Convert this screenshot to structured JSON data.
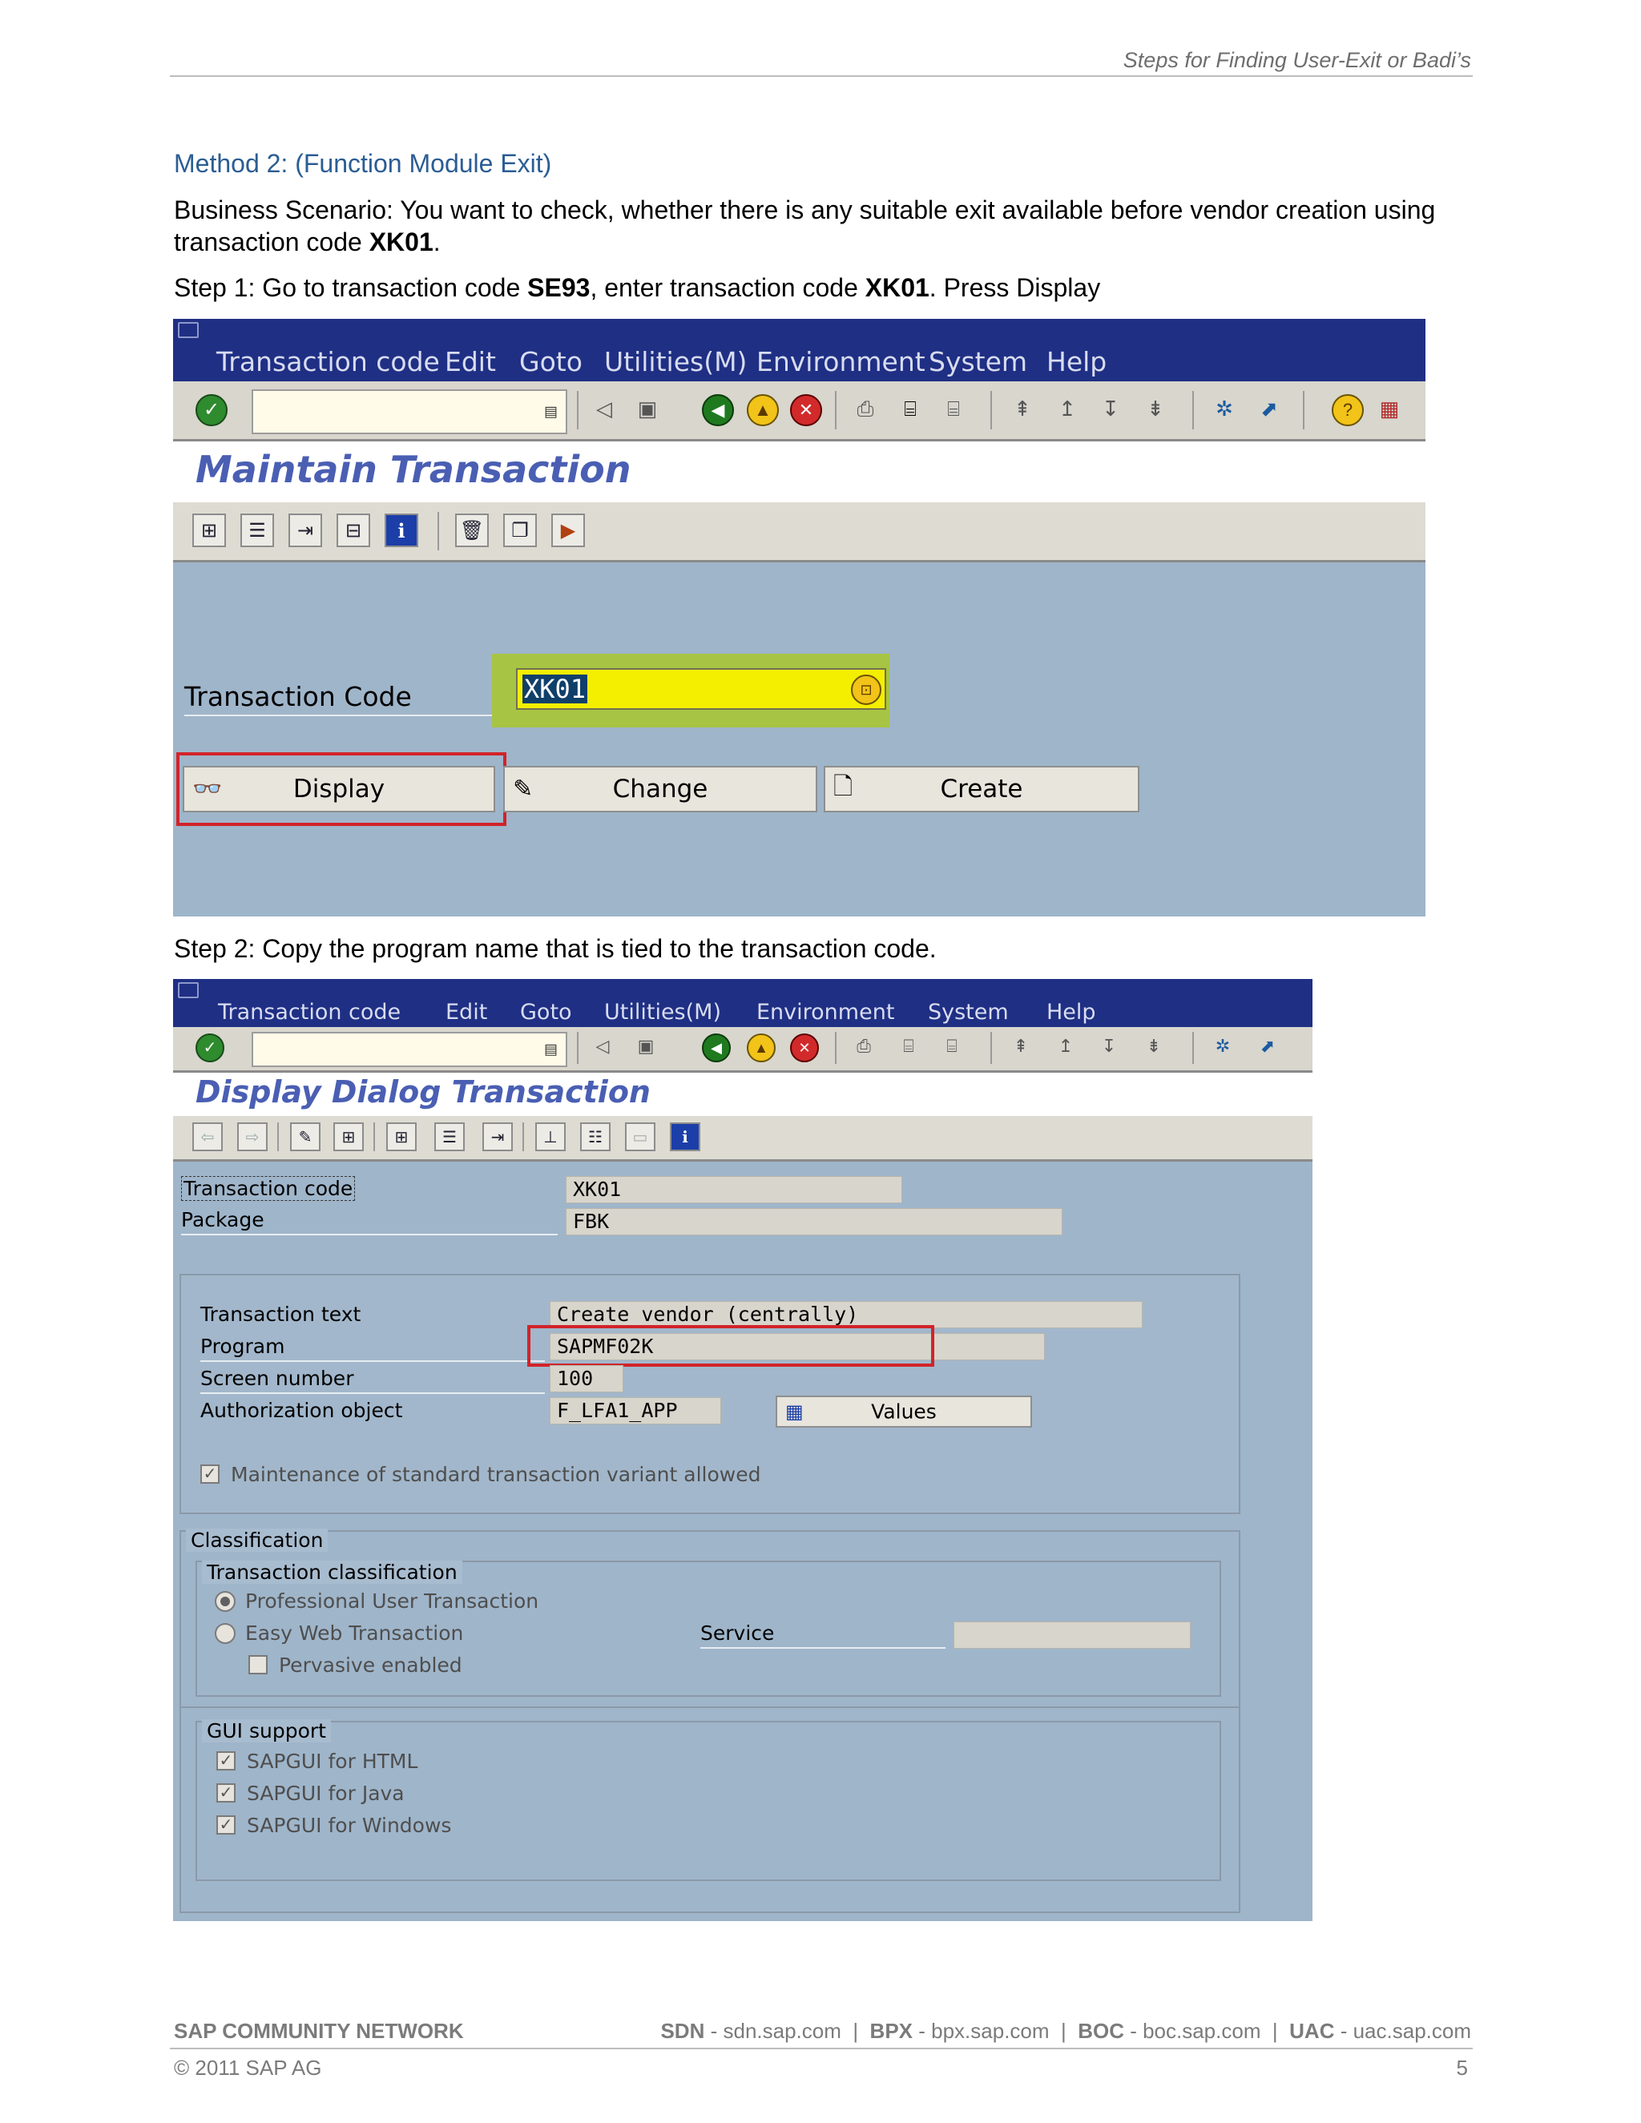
{
  "header": {
    "title": "Steps for Finding User-Exit or Badi’s"
  },
  "method_title": "Method 2: (Function Module Exit)",
  "scenario": {
    "prefix": "Business Scenario: You want to check, whether there is any suitable exit available before vendor creation using transaction code ",
    "code": "XK01",
    "suffix": "."
  },
  "step1": {
    "prefix": "Step 1: Go to transaction code ",
    "code1": "SE93",
    "middle": ", enter transaction code ",
    "code2": "XK01",
    "suffix": ". Press Display"
  },
  "step2": {
    "text": "Step 2:  Copy the program name that is tied to the transaction code."
  },
  "menu": {
    "items": [
      "Transaction code",
      "Edit",
      "Goto",
      "Utilities(M)",
      "Environment",
      "System",
      "Help"
    ]
  },
  "screen1": {
    "title": "Maintain Transaction",
    "tcode_label": "Transaction Code",
    "tcode_value": "XK01",
    "buttons": {
      "display": "Display",
      "change": "Change",
      "create": "Create"
    }
  },
  "screen2": {
    "title": "Display Dialog Transaction",
    "fields": {
      "tcode_label": "Transaction code",
      "tcode_value": "XK01",
      "package_label": "Package",
      "package_value": "FBK",
      "ttext_label": "Transaction text",
      "ttext_value": "Create vendor (centrally)",
      "program_label": "Program",
      "program_value": "SAPMF02K",
      "screen_label": "Screen number",
      "screen_value": "100",
      "auth_label": "Authorization object",
      "auth_value": "F_LFA1_APP",
      "values_button": "Values",
      "maintenance_label": "Maintenance of standard transaction variant allowed"
    },
    "classification": {
      "title": "Classification",
      "sub_title": "Transaction classification",
      "professional": "Professional User Transaction",
      "easy_web": "Easy Web Transaction",
      "service_label": "Service",
      "pervasive": "Pervasive enabled"
    },
    "gui_support": {
      "title": "GUI support",
      "html": "SAPGUI for HTML",
      "java": "SAPGUI for Java",
      "windows": "SAPGUI for Windows"
    }
  },
  "footer": {
    "left": "SAP COMMUNITY NETWORK",
    "links": [
      {
        "key": "SDN",
        "url": "sdn.sap.com"
      },
      {
        "key": "BPX",
        "url": "bpx.sap.com"
      },
      {
        "key": "BOC",
        "url": "boc.sap.com"
      },
      {
        "key": "UAC",
        "url": "uac.sap.com"
      }
    ],
    "copyright": "© 2011 SAP AG",
    "page_number": "5"
  },
  "icons": [
    "enter-icon",
    "save-icon",
    "back-icon",
    "exit-icon",
    "cancel-icon",
    "print-icon",
    "find-icon",
    "help-icon",
    "info-icon",
    "display-glasses-icon",
    "pencil-icon",
    "document-icon",
    "values-table-icon"
  ],
  "colors": {
    "menu_bar": "#1f2f84",
    "screen_bg": "#9fb5ca",
    "tcode_input": "#f4ee00",
    "highlight_box": "#d2232a",
    "method_title": "#2b5d94"
  }
}
